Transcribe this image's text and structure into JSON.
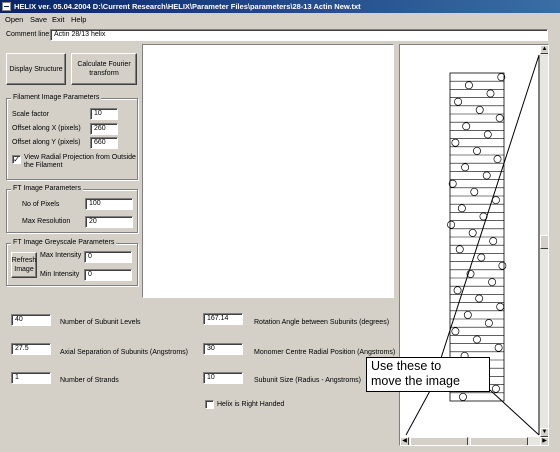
{
  "window": {
    "title": "HELIX ver. 05.04.2004  D:\\Current Research\\HELIX\\Parameter Files\\parameters\\28-13 Actin New.txt"
  },
  "menu": [
    "Open",
    "Save",
    "Exit",
    "Help"
  ],
  "comment": {
    "label": "Comment line:",
    "value": "Actin 28/13 helix"
  },
  "buttons": {
    "display_structure": "Display Structure",
    "calculate_fourier": "Calculate  Fourier transform",
    "refresh_image": "Refresh Image"
  },
  "filament_params": {
    "title": "Filament Image Parameters",
    "scale_factor_label": "Scale factor",
    "scale_factor_value": "10",
    "offset_x_label": "Offset along X (pixels)",
    "offset_x_value": "260",
    "offset_y_label": "Offset along Y (pixels)",
    "offset_y_value": "660",
    "view_radial_label": "View Radial Projection from Outside the Filament",
    "view_radial_checked": true
  },
  "ft_params": {
    "title": "FT Image Parameters",
    "no_pixels_label": "No of Pixels",
    "no_pixels_value": "100",
    "max_resolution_label": "Max Resolution",
    "max_resolution_value": "20"
  },
  "greyscale": {
    "title": "FT Image Greyscale Parameters",
    "max_intensity_label": "Max Intensity",
    "max_intensity_value": "0",
    "min_intensity_label": "Min Intensity",
    "min_intensity_value": "0"
  },
  "helix_params": {
    "subunit_levels_value": "40",
    "subunit_levels_label": "Number of Subunit Levels",
    "axial_sep_value": "27.5",
    "axial_sep_label": "Axial Separation of Subunits (Angstroms)",
    "strands_value": "1",
    "strands_label": "Number of Strands",
    "rotation_value": "167.14",
    "rotation_label": "Rotation Angle between Subunits (degrees)",
    "radial_pos_value": "30",
    "radial_pos_label": "Monomer Centre Radial Position (Angstroms)",
    "subunit_size_value": "10",
    "subunit_size_label": "Subunit Size (Radius - Angstroms)",
    "right_handed_label": "Helix is Right Handed",
    "right_handed_checked": false
  },
  "callout": {
    "line1": "Use these to",
    "line2": "move the image"
  },
  "structure": {
    "stripe_color": "#000000",
    "subunit_color": "#000000",
    "subunit_positions_fraction": [
      0.95,
      0.35,
      0.75,
      0.15,
      0.55,
      0.92,
      0.3,
      0.7,
      0.1,
      0.5,
      0.88,
      0.28,
      0.68,
      0.05,
      0.45,
      0.85,
      0.22,
      0.62,
      0.02,
      0.42,
      0.8,
      0.18,
      0.58,
      0.97,
      0.38,
      0.78,
      0.14,
      0.54,
      0.93,
      0.33,
      0.72,
      0.1,
      0.5,
      0.9,
      0.27,
      0.66,
      0.06,
      0.46,
      0.85,
      0.24
    ]
  }
}
